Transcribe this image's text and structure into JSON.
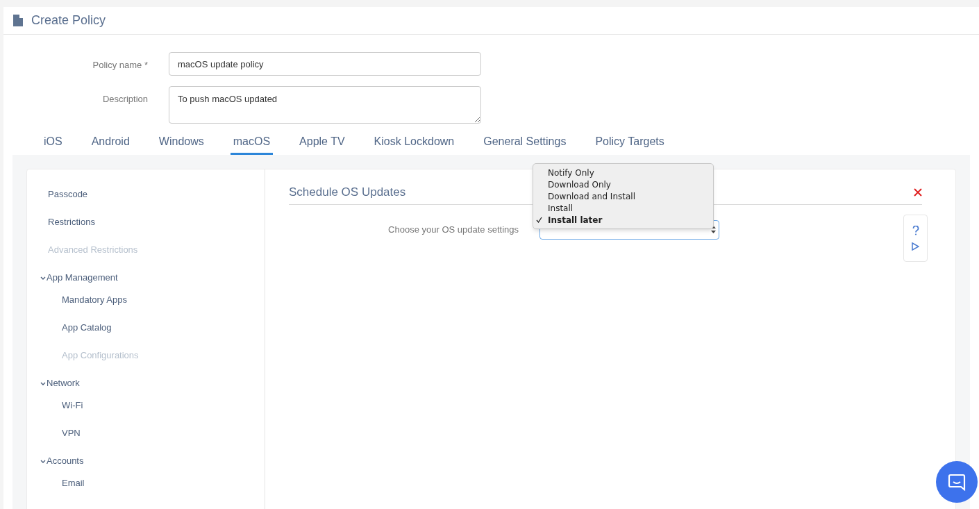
{
  "header": {
    "title": "Create Policy"
  },
  "form": [
    {
      "kind": "input",
      "label": "Policy name *",
      "value": "macOS update policy"
    },
    {
      "kind": "textarea",
      "label": "Description",
      "value": "To push macOS updated"
    }
  ],
  "tabs": [
    {
      "label": "iOS",
      "selected": false
    },
    {
      "label": "Android",
      "selected": false
    },
    {
      "label": "Windows",
      "selected": false
    },
    {
      "label": "macOS",
      "selected": true
    },
    {
      "label": "Apple TV",
      "selected": false
    },
    {
      "label": "Kiosk Lockdown",
      "selected": false
    },
    {
      "label": "General Settings",
      "selected": false
    },
    {
      "label": "Policy Targets",
      "selected": false
    }
  ],
  "sidebar": {
    "items": [
      {
        "label": "Passcode",
        "disabled": false
      },
      {
        "label": "Restrictions",
        "disabled": false
      },
      {
        "label": "Advanced Restrictions",
        "disabled": true
      },
      {
        "label": "App Management",
        "expanded": true,
        "children": [
          {
            "label": "Mandatory Apps",
            "disabled": false
          },
          {
            "label": "App Catalog",
            "disabled": false
          },
          {
            "label": "App Configurations",
            "disabled": true
          }
        ]
      },
      {
        "label": "Network",
        "expanded": true,
        "children": [
          {
            "label": "Wi-Fi",
            "disabled": false
          },
          {
            "label": "VPN",
            "disabled": false
          }
        ]
      },
      {
        "label": "Accounts",
        "expanded": true,
        "children": [
          {
            "label": "Email",
            "disabled": false
          }
        ]
      }
    ]
  },
  "section": {
    "title": "Schedule OS Updates",
    "setting_label": "Choose your OS update settings",
    "dropdown": {
      "open": true,
      "options": [
        {
          "label": "Notify Only",
          "selected": false
        },
        {
          "label": "Download Only",
          "selected": false
        },
        {
          "label": "Download and Install",
          "selected": false
        },
        {
          "label": "Install",
          "selected": false
        },
        {
          "label": "Install later",
          "selected": true
        }
      ]
    }
  }
}
